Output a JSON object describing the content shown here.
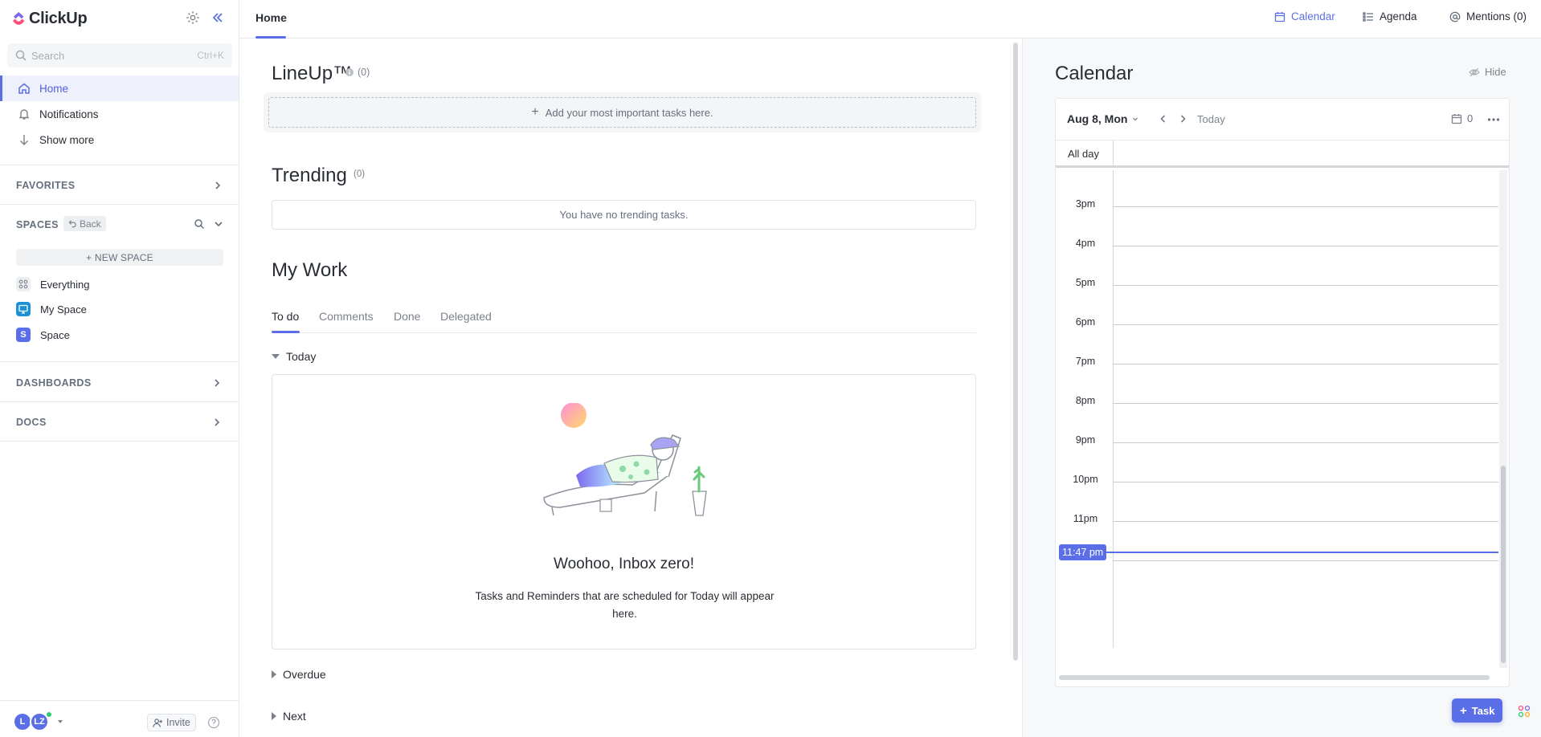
{
  "app": {
    "logo_text": "ClickUp",
    "accent": "#5a6ee8"
  },
  "sidebar": {
    "search_placeholder": "Search",
    "search_shortcut": "Ctrl+K",
    "nav": [
      {
        "label": "Home",
        "icon": "home-icon",
        "active": true
      },
      {
        "label": "Notifications",
        "icon": "bell-icon",
        "active": false
      },
      {
        "label": "Show more",
        "icon": "arrow-down-icon",
        "active": false
      }
    ],
    "favorites_label": "FAVORITES",
    "spaces_label": "SPACES",
    "back_label": "Back",
    "new_space_label": "+ NEW SPACE",
    "spaces": [
      {
        "label": "Everything",
        "icon": "grid-icon"
      },
      {
        "label": "My Space",
        "icon": "monitor-icon",
        "color": "#1e90d6"
      },
      {
        "label": "Space",
        "badge": "S",
        "color": "#5a6ee8"
      }
    ],
    "dashboards_label": "DASHBOARDS",
    "docs_label": "DOCS",
    "footer": {
      "avatar_1": "L",
      "avatar_2": "LZ",
      "invite_label": "Invite"
    }
  },
  "topbar": {
    "home_tab": "Home",
    "views": [
      {
        "label": "Calendar",
        "icon": "calendar-icon",
        "active": true
      },
      {
        "label": "Agenda",
        "icon": "list-icon",
        "active": false
      },
      {
        "label": "Mentions (0)",
        "icon": "at-icon",
        "active": false
      }
    ]
  },
  "main": {
    "lineup": {
      "title": "LineUp™",
      "count": "(0)",
      "add_label": "Add your most important tasks here."
    },
    "trending": {
      "title": "Trending",
      "count": "(0)",
      "empty": "You have no trending tasks."
    },
    "my_work": {
      "title": "My Work",
      "tabs": [
        "To do",
        "Comments",
        "Done",
        "Delegated"
      ],
      "active_tab": "To do",
      "groups": {
        "today": "Today",
        "overdue": "Overdue",
        "next": "Next"
      },
      "empty_title": "Woohoo, Inbox zero!",
      "empty_sub": "Tasks and Reminders that are scheduled for Today will appear here."
    }
  },
  "calendar": {
    "title": "Calendar",
    "hide_label": "Hide",
    "date_label": "Aug 8, Mon",
    "today_label": "Today",
    "count": "0",
    "all_day_label": "All day",
    "hours": [
      "3pm",
      "4pm",
      "5pm",
      "6pm",
      "7pm",
      "8pm",
      "9pm",
      "10pm",
      "11pm"
    ],
    "now_label": "11:47 pm",
    "task_button": "Task"
  }
}
